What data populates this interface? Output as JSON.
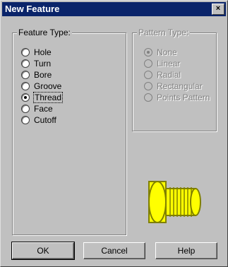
{
  "window": {
    "title": "New Feature",
    "close_label": "×"
  },
  "feature_type": {
    "label": "Feature Type:",
    "options": [
      "Hole",
      "Turn",
      "Bore",
      "Groove",
      "Thread",
      "Face",
      "Cutoff"
    ],
    "selected": "Thread"
  },
  "pattern_type": {
    "label": "Pattern Type:",
    "options": [
      "None",
      "Linear",
      "Radial",
      "Rectangular",
      "Points Pattern"
    ],
    "selected": "None",
    "enabled": false
  },
  "preview": {
    "icon": "threaded-cylinder-icon",
    "body_color": "#ffff00",
    "outline_color": "#808000"
  },
  "buttons": {
    "ok": "OK",
    "cancel": "Cancel",
    "help": "Help"
  }
}
